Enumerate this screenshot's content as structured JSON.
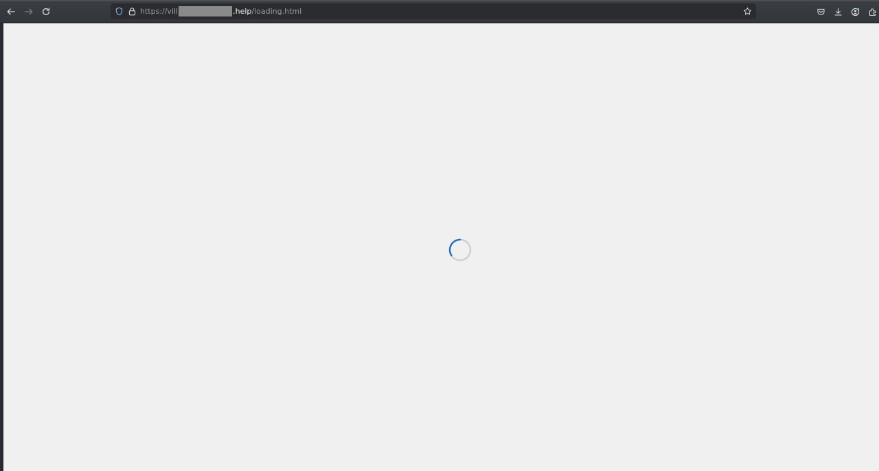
{
  "browser": {
    "nav": {
      "back_icon": "back-arrow-icon",
      "forward_icon": "forward-arrow-icon",
      "reload_icon": "reload-icon"
    },
    "url": {
      "prefix": "https://vill",
      "host_suffix": ".help",
      "path": "/loading.html",
      "redacted": true
    },
    "url_icons": [
      "shield-icon",
      "lock-icon"
    ],
    "bookmark_icon": "star-icon",
    "toolbar_icons": [
      "pocket-icon",
      "download-icon",
      "account-icon",
      "extensions-icon"
    ]
  },
  "page": {
    "state": "loading",
    "background": "#f0f0f0",
    "spinner_color": "#2f6dc4",
    "spinner_track_color": "#cfcfd2"
  }
}
